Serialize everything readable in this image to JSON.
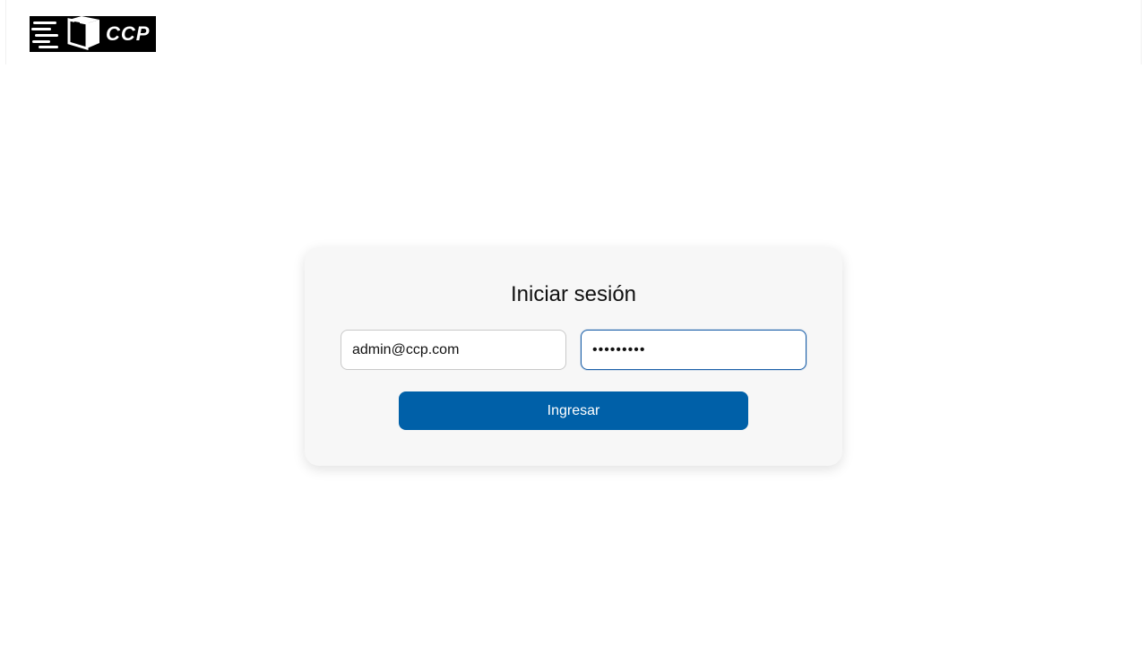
{
  "header": {
    "logo_text": "CCP",
    "logo_icon": "delivery-box-icon"
  },
  "login": {
    "title": "Iniciar sesión",
    "email_value": "admin@ccp.com",
    "password_value": "contraseñ",
    "submit_label": "Ingresar"
  },
  "colors": {
    "primary": "#0060a8",
    "card_bg": "#f7f7f7",
    "focus_border": "#1a5fa8"
  }
}
